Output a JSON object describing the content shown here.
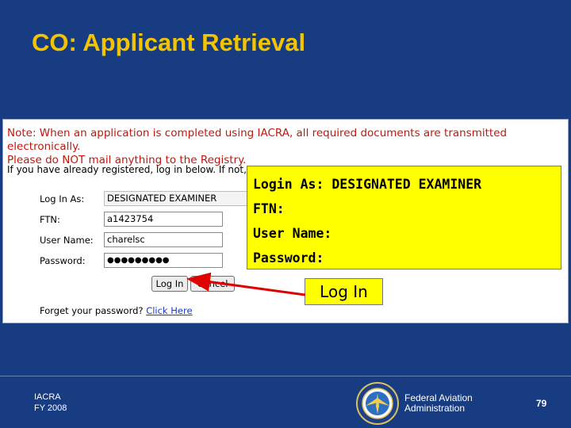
{
  "slide": {
    "title": "CO: Applicant Retrieval"
  },
  "form": {
    "note_line1": "Note: When an application is completed using IACRA, all required documents are transmitted electronically.",
    "note_line2": "Please do NOT mail anything to the Registry.",
    "intro": "If you have already registered, log in below. If not,",
    "log_in_as_label": "Log In As:",
    "log_in_as_value": "DESIGNATED EXAMINER",
    "ftn_label": "FTN:",
    "ftn_value": "a1423754",
    "username_label": "User Name:",
    "username_value": "charelsc",
    "password_label": "Password:",
    "password_value": "●●●●●●●●●",
    "login_button": "Log In",
    "cancel_button": "Cancel",
    "forgot_text": "Forget your password?",
    "forgot_link": "Click Here"
  },
  "callout": {
    "login_as": "Login As: DESIGNATED EXAMINER",
    "ftn": "FTN:",
    "username": "User Name:",
    "password": "Password:",
    "login_label": "Log In"
  },
  "footer": {
    "org_line1": "IACRA",
    "org_line2": "FY 2008",
    "faa_line1": "Federal Aviation",
    "faa_line2": "Administration",
    "page_number": "79"
  },
  "colors": {
    "background": "#183c82",
    "title": "#f4c400",
    "note": "#c0180e",
    "callout": "#ffff00",
    "arrow": "#e00000"
  }
}
